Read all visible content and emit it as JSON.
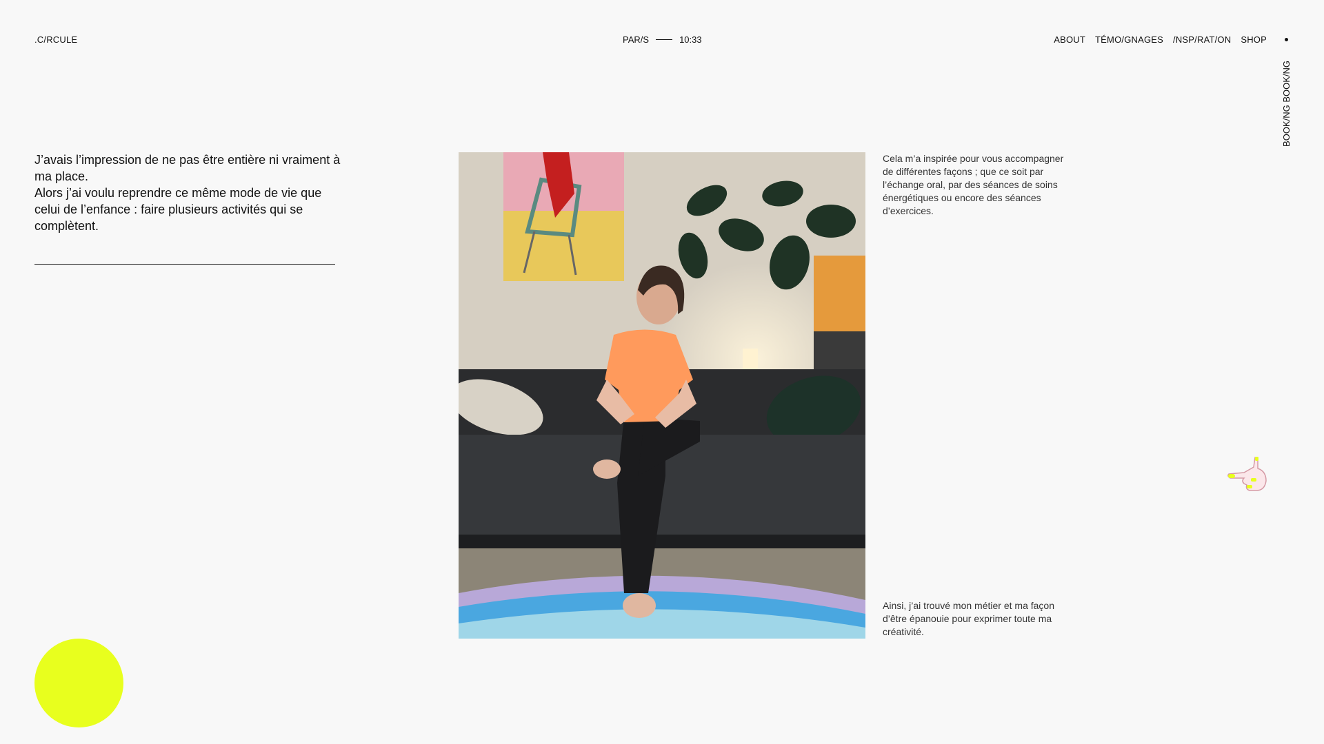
{
  "header": {
    "logo": ".C/RCULE",
    "city": "PAR/S",
    "time": "10:33",
    "nav": [
      "ABOUT",
      "TÉMO/GNAGES",
      "/NSP/RAT/ON",
      "SHOP"
    ],
    "booking": "BOOK/NG BOOK/NG"
  },
  "intro": {
    "line1": "J’avais l’impression de ne pas être entière ni vraiment à ma place.",
    "line2": "Alors j’ai voulu reprendre ce même mode de vie que celui de l’enfance : faire plusieurs activités qui se complètent."
  },
  "side": {
    "top": "Cela m’a inspirée pour vous accompagner de différentes façons ; que ce soit par l’échange oral, par des séances de soins énergétiques ou encore des séances d’exercices.",
    "bottom": "Ainsi, j’ai trouvé mon métier et ma façon d’être épanouie pour exprimer toute ma créativité."
  },
  "colors": {
    "background": "#f8f8f8",
    "accent_circle": "#e8ff1e",
    "text": "#111111"
  },
  "icons": {
    "cursor": "pointing-hand-icon",
    "nav_dot": "dot-icon"
  }
}
